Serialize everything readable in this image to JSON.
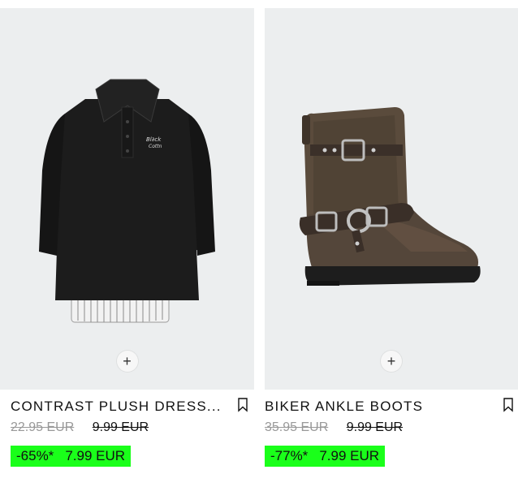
{
  "products": [
    {
      "name": "CONTRAST PLUSH DRESS...",
      "original_price": "22.95 EUR",
      "crossed_price": "9.99 EUR",
      "discount": "-65%*",
      "sale_price": "7.99 EUR",
      "image": "black-polo-sweatshirt-dress"
    },
    {
      "name": "BIKER ANKLE BOOTS",
      "original_price": "35.95 EUR",
      "crossed_price": "9.99 EUR",
      "discount": "-77%*",
      "sale_price": "7.99 EUR",
      "image": "brown-biker-boot"
    }
  ],
  "colors": {
    "discount_badge": "#1aff1a",
    "image_background": "#eceeef"
  },
  "icons": {
    "add": "+",
    "bookmark": "bookmark-icon"
  }
}
